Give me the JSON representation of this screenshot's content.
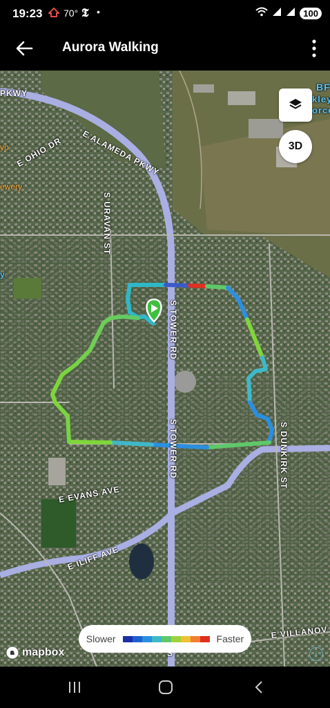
{
  "status": {
    "time": "19:23",
    "temperature": "70°",
    "news_glyph": "𝕿",
    "dot": "•",
    "battery": "100"
  },
  "appbar": {
    "title": "Aurora Walking"
  },
  "map": {
    "labels": {
      "e_alameda_pkwy": "E ALAMEDA PKWY",
      "pkwy_fragment": "PKWY",
      "e_ohio_dr": "E OHIO DR",
      "s_uravan_st": "S URAVAN ST",
      "s_tower_rd_north": "S TOWER RD",
      "s_tower_rd_south": "S TOWER RD",
      "s_dunkirk_st": "S DUNKIRK ST",
      "e_evans_ave": "E EVANS AVE",
      "e_iliff_ave": "E ILIFF AVE",
      "e_villanova": "E VILLANOV",
      "bf_fragment": "BF",
      "kley_fragment": "kley",
      "orce_fragment": "orce",
      "yo_fragment": "yo",
      "ewery_fragment": "ewery",
      "y_fragment": "y",
      "s_fragment": "S"
    },
    "layers_icon": "layers-icon",
    "btn_3d": "3D"
  },
  "legend": {
    "slower": "Slower",
    "faster": "Faster",
    "colors": [
      "#1a2fa8",
      "#1f5fd0",
      "#2b8fe0",
      "#3fb8c8",
      "#5fc86a",
      "#9fd23a",
      "#f0c030",
      "#f08030",
      "#e03020"
    ]
  },
  "attribution": {
    "brand": "mapbox",
    "info": "i"
  }
}
